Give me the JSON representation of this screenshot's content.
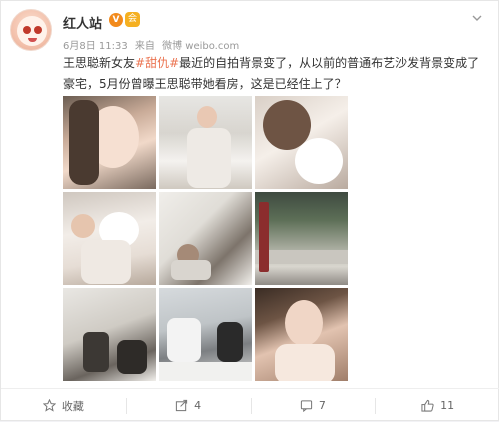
{
  "post": {
    "username": "红人站",
    "verified_badge": "V",
    "member_badge": "会",
    "timestamp": "6月8日 11:33",
    "source_prefix": "来自",
    "source": "微博 weibo.com",
    "text_part1": "王思聪新女友",
    "topic": "#甜仇#",
    "text_part2": "最近的自拍背景变了，从以前的普通布艺沙发背景变成了豪宅，5月份曾曝王思聪带她看房，这是已经住上了？",
    "photo_count": 9
  },
  "actions": {
    "favorite_label": "收藏",
    "repost_count": "4",
    "comment_count": "7",
    "like_count": "11"
  },
  "colors": {
    "topic": "#eb7350",
    "verified": "#f28a1c",
    "member": "#f5b021"
  }
}
